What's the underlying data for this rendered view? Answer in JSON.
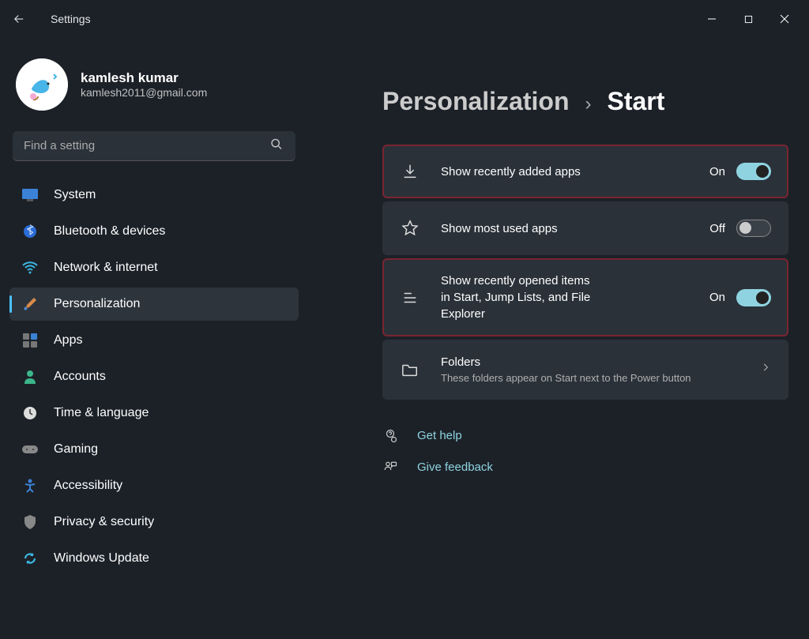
{
  "app": {
    "title": "Settings"
  },
  "user": {
    "name": "kamlesh kumar",
    "email": "kamlesh2011@gmail.com"
  },
  "search": {
    "placeholder": "Find a setting"
  },
  "nav": {
    "items": [
      {
        "label": "System",
        "active": false
      },
      {
        "label": "Bluetooth & devices",
        "active": false
      },
      {
        "label": "Network & internet",
        "active": false
      },
      {
        "label": "Personalization",
        "active": true
      },
      {
        "label": "Apps",
        "active": false
      },
      {
        "label": "Accounts",
        "active": false
      },
      {
        "label": "Time & language",
        "active": false
      },
      {
        "label": "Gaming",
        "active": false
      },
      {
        "label": "Accessibility",
        "active": false
      },
      {
        "label": "Privacy & security",
        "active": false
      },
      {
        "label": "Windows Update",
        "active": false
      }
    ]
  },
  "breadcrumb": {
    "parent": "Personalization",
    "separator": "›",
    "current": "Start"
  },
  "settings": {
    "rows": [
      {
        "title": "Show recently added apps",
        "state": "On",
        "on": true,
        "highlight": true
      },
      {
        "title": "Show most used apps",
        "state": "Off",
        "on": false,
        "highlight": false
      },
      {
        "title": "Show recently opened items in Start, Jump Lists, and File Explorer",
        "state": "On",
        "on": true,
        "highlight": true
      }
    ],
    "folders": {
      "title": "Folders",
      "subtitle": "These folders appear on Start next to the Power button"
    }
  },
  "help": {
    "get_help": "Get help",
    "give_feedback": "Give feedback"
  }
}
